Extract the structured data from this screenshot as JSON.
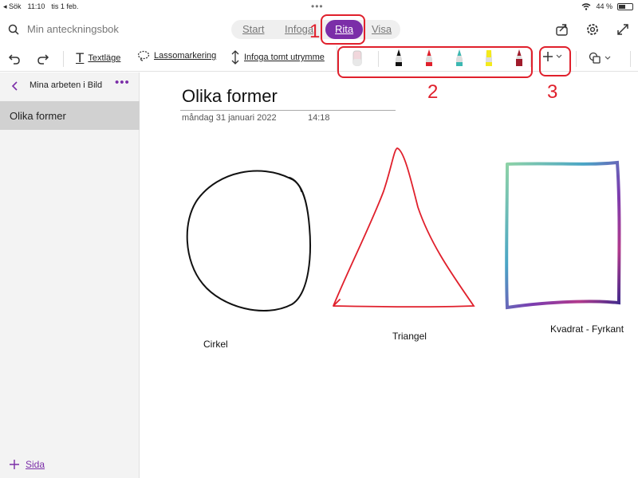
{
  "status": {
    "back_app": "Sök",
    "time": "11:10",
    "date": "tis 1 feb.",
    "battery": "44 %"
  },
  "topbar": {
    "search_placeholder": "Min anteckningsbok",
    "tabs": [
      {
        "label": "Start",
        "active": false
      },
      {
        "label": "Infoga",
        "active": false
      },
      {
        "label": "Rita",
        "active": true
      },
      {
        "label": "Visa",
        "active": false
      }
    ]
  },
  "toolbar": {
    "text_mode": "Textläge",
    "lasso": "Lassomarkering",
    "insert_space": "Infoga tomt utrymme",
    "pens": [
      {
        "kind": "eraser",
        "color": "#e9a9b6"
      },
      {
        "kind": "pen",
        "color": "#111111"
      },
      {
        "kind": "pen",
        "color": "#e0202c"
      },
      {
        "kind": "pen",
        "color": "#3cb8b2"
      },
      {
        "kind": "highlighter",
        "color": "#f4ea1c"
      },
      {
        "kind": "pen",
        "color": "#a01c2c"
      }
    ]
  },
  "sidebar": {
    "section": "Mina arbeten i Bild",
    "pages": [
      "Olika former"
    ],
    "add_page": "Sida"
  },
  "page": {
    "title": "Olika former",
    "date": "måndag 31 januari 2022",
    "time": "14:18",
    "labels": {
      "circle": "Cirkel",
      "triangle": "Triangel",
      "square": "Kvadrat - Fyrkant"
    }
  },
  "annotations": [
    "1",
    "2",
    "3"
  ],
  "colors": {
    "accent": "#7b2ea8",
    "annotation": "#e0202c"
  }
}
